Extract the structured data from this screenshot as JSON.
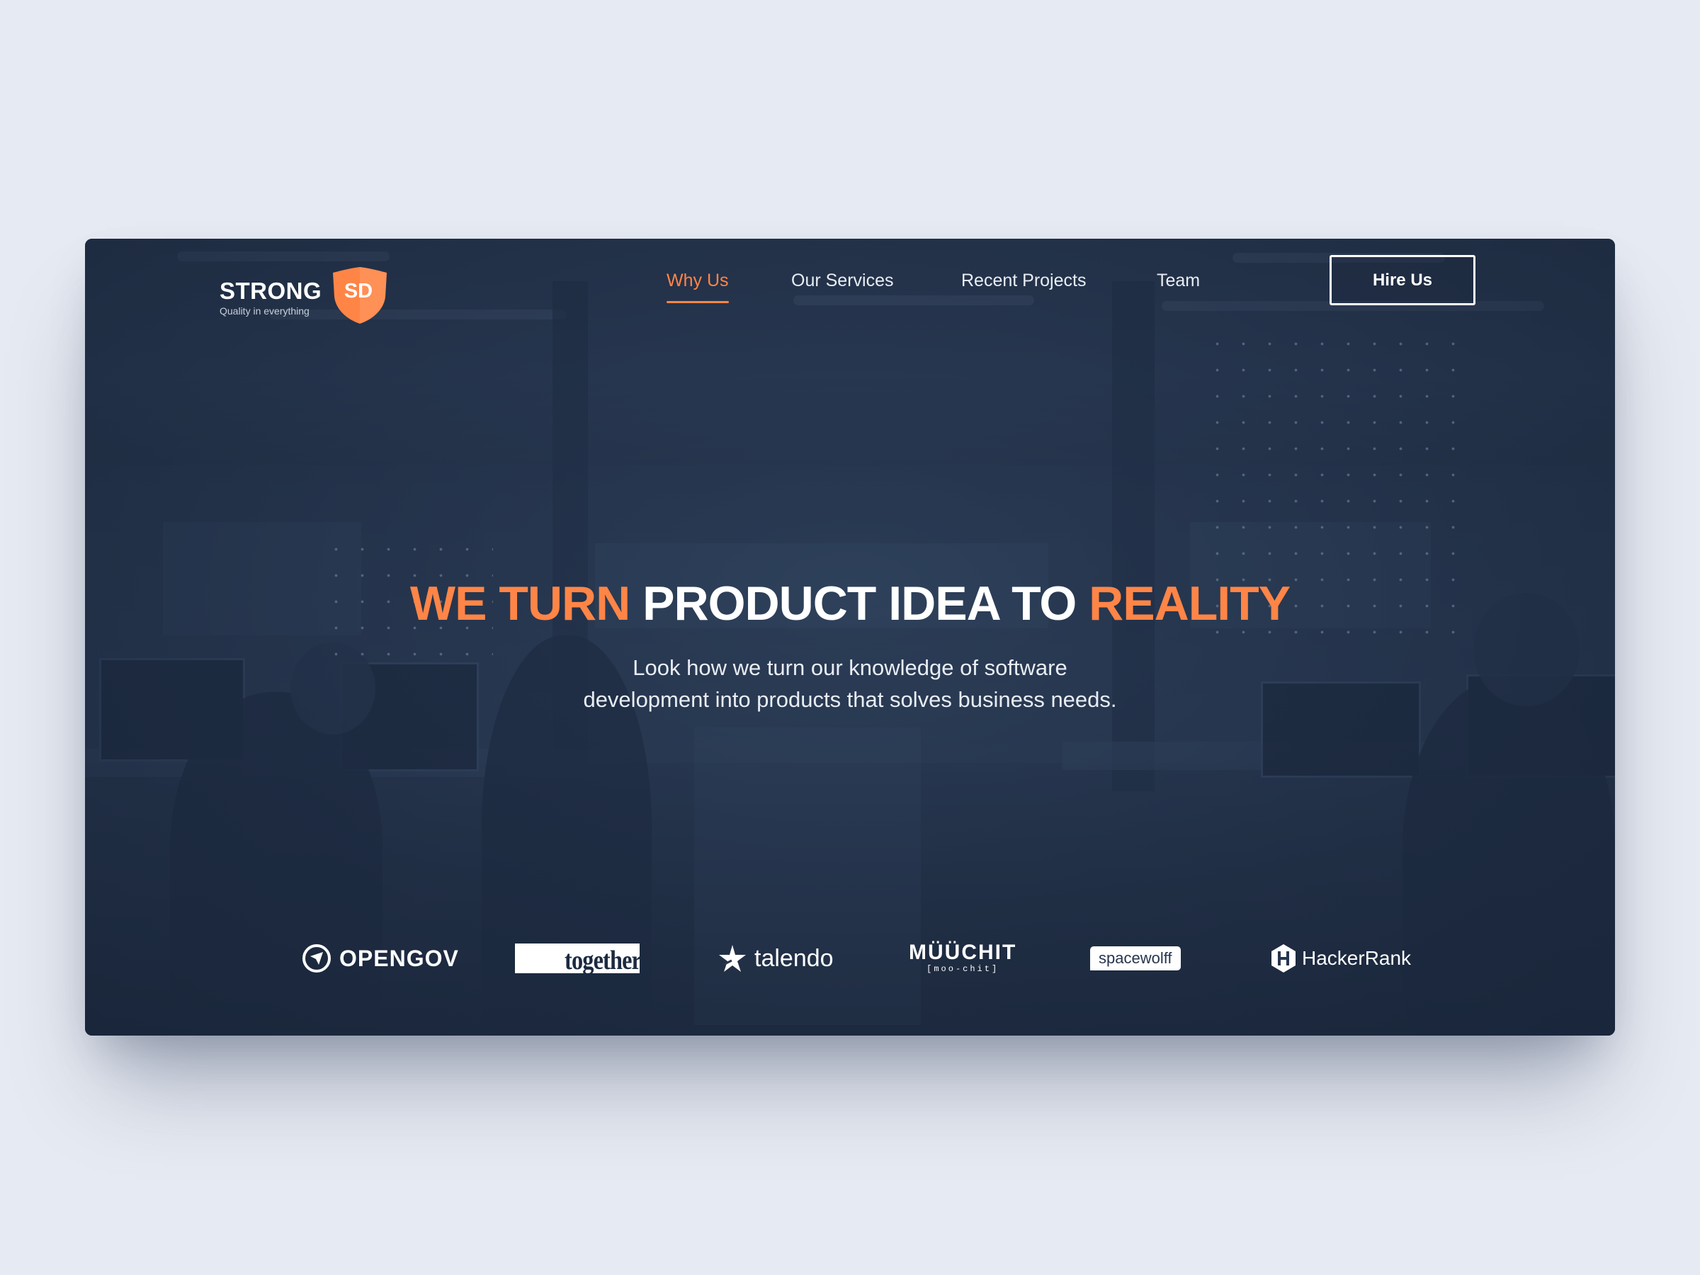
{
  "brand": {
    "name": "STRONG",
    "badge": "SD",
    "tagline": "Quality in everything",
    "accent_color": "#ff8547"
  },
  "nav": {
    "items": [
      {
        "label": "Why Us",
        "active": true
      },
      {
        "label": "Our Services",
        "active": false
      },
      {
        "label": "Recent Projects",
        "active": false
      },
      {
        "label": "Team",
        "active": false
      }
    ],
    "cta": "Hire Us"
  },
  "hero": {
    "title_part1": "WE TURN",
    "title_part2": "PRODUCT IDEA TO",
    "title_part3": "REALITY",
    "subtitle_line1": "Look how we turn our knowledge of software",
    "subtitle_line2": "development into products that solves business needs."
  },
  "clients": [
    {
      "name": "OPENGOV",
      "icon": "opengov-logo-icon"
    },
    {
      "name": "together",
      "icon": "together-logo"
    },
    {
      "name": "talendo",
      "icon": "talendo-star-icon"
    },
    {
      "name": "MÜÜCHIT",
      "sub": "[moo-chit]",
      "icon": "muuchit-logo"
    },
    {
      "name": "spacewolff",
      "icon": "spacewolff-logo"
    },
    {
      "name": "HackerRank",
      "icon": "hackerrank-hex-icon"
    }
  ],
  "colors": {
    "page_background": "#e6eaf2",
    "hero_overlay": "#26364e",
    "text_primary": "#ffffff"
  }
}
